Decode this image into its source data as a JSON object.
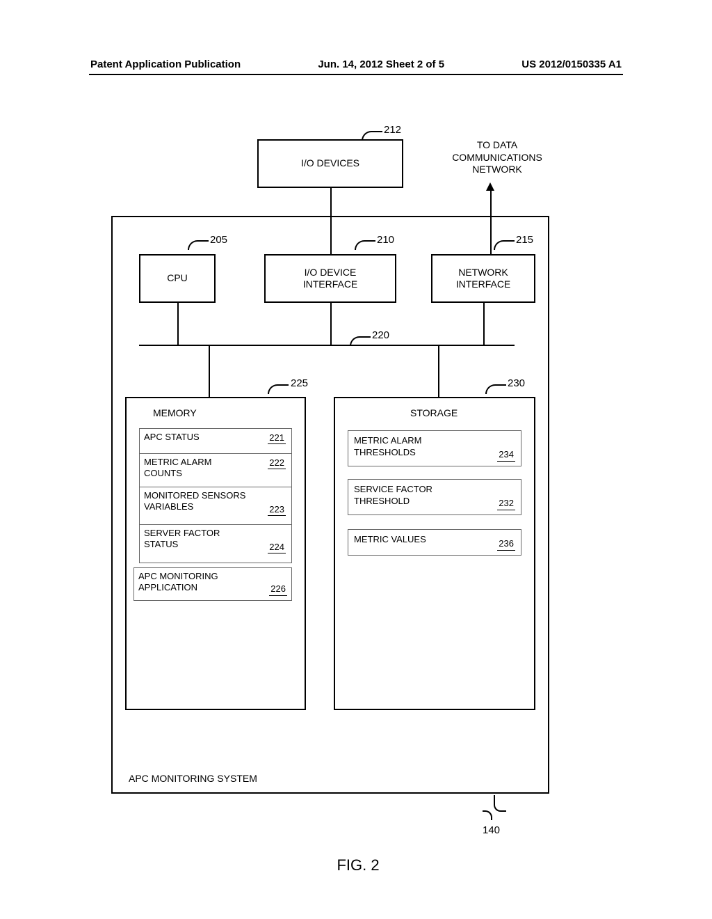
{
  "header": {
    "left": "Patent Application Publication",
    "center": "Jun. 14, 2012  Sheet 2 of 5",
    "right": "US 2012/0150335 A1"
  },
  "external_text": "TO DATA\nCOMMUNICATIONS\nNETWORK",
  "io_devices": {
    "label": "I/O DEVICES",
    "ref": "212"
  },
  "cpu": {
    "label": "CPU",
    "ref": "205"
  },
  "io_iface": {
    "label": "I/O DEVICE\nINTERFACE",
    "ref": "210"
  },
  "net_iface": {
    "label": "NETWORK\nINTERFACE",
    "ref": "215"
  },
  "bus": {
    "ref": "220"
  },
  "memory": {
    "title": "MEMORY",
    "ref": "225",
    "items": [
      {
        "label": "APC STATUS",
        "ref": "221"
      },
      {
        "label": "METRIC ALARM\nCOUNTS",
        "ref": "222"
      },
      {
        "label": "MONITORED SENSORS\nVARIABLES",
        "ref": "223"
      },
      {
        "label": "SERVER FACTOR\nSTATUS",
        "ref": "224"
      }
    ],
    "tail": {
      "label": "APC MONITORING\nAPPLICATION",
      "ref": "226"
    }
  },
  "storage": {
    "title": "STORAGE",
    "ref": "230",
    "items": [
      {
        "label": "METRIC ALARM\nTHRESHOLDS",
        "ref": "234"
      },
      {
        "label": "SERVICE FACTOR\nTHRESHOLD",
        "ref": "232"
      },
      {
        "label": "METRIC VALUES",
        "ref": "236"
      }
    ]
  },
  "system_label": "APC MONITORING SYSTEM",
  "system_ref": "140",
  "figure_caption": "FIG. 2"
}
